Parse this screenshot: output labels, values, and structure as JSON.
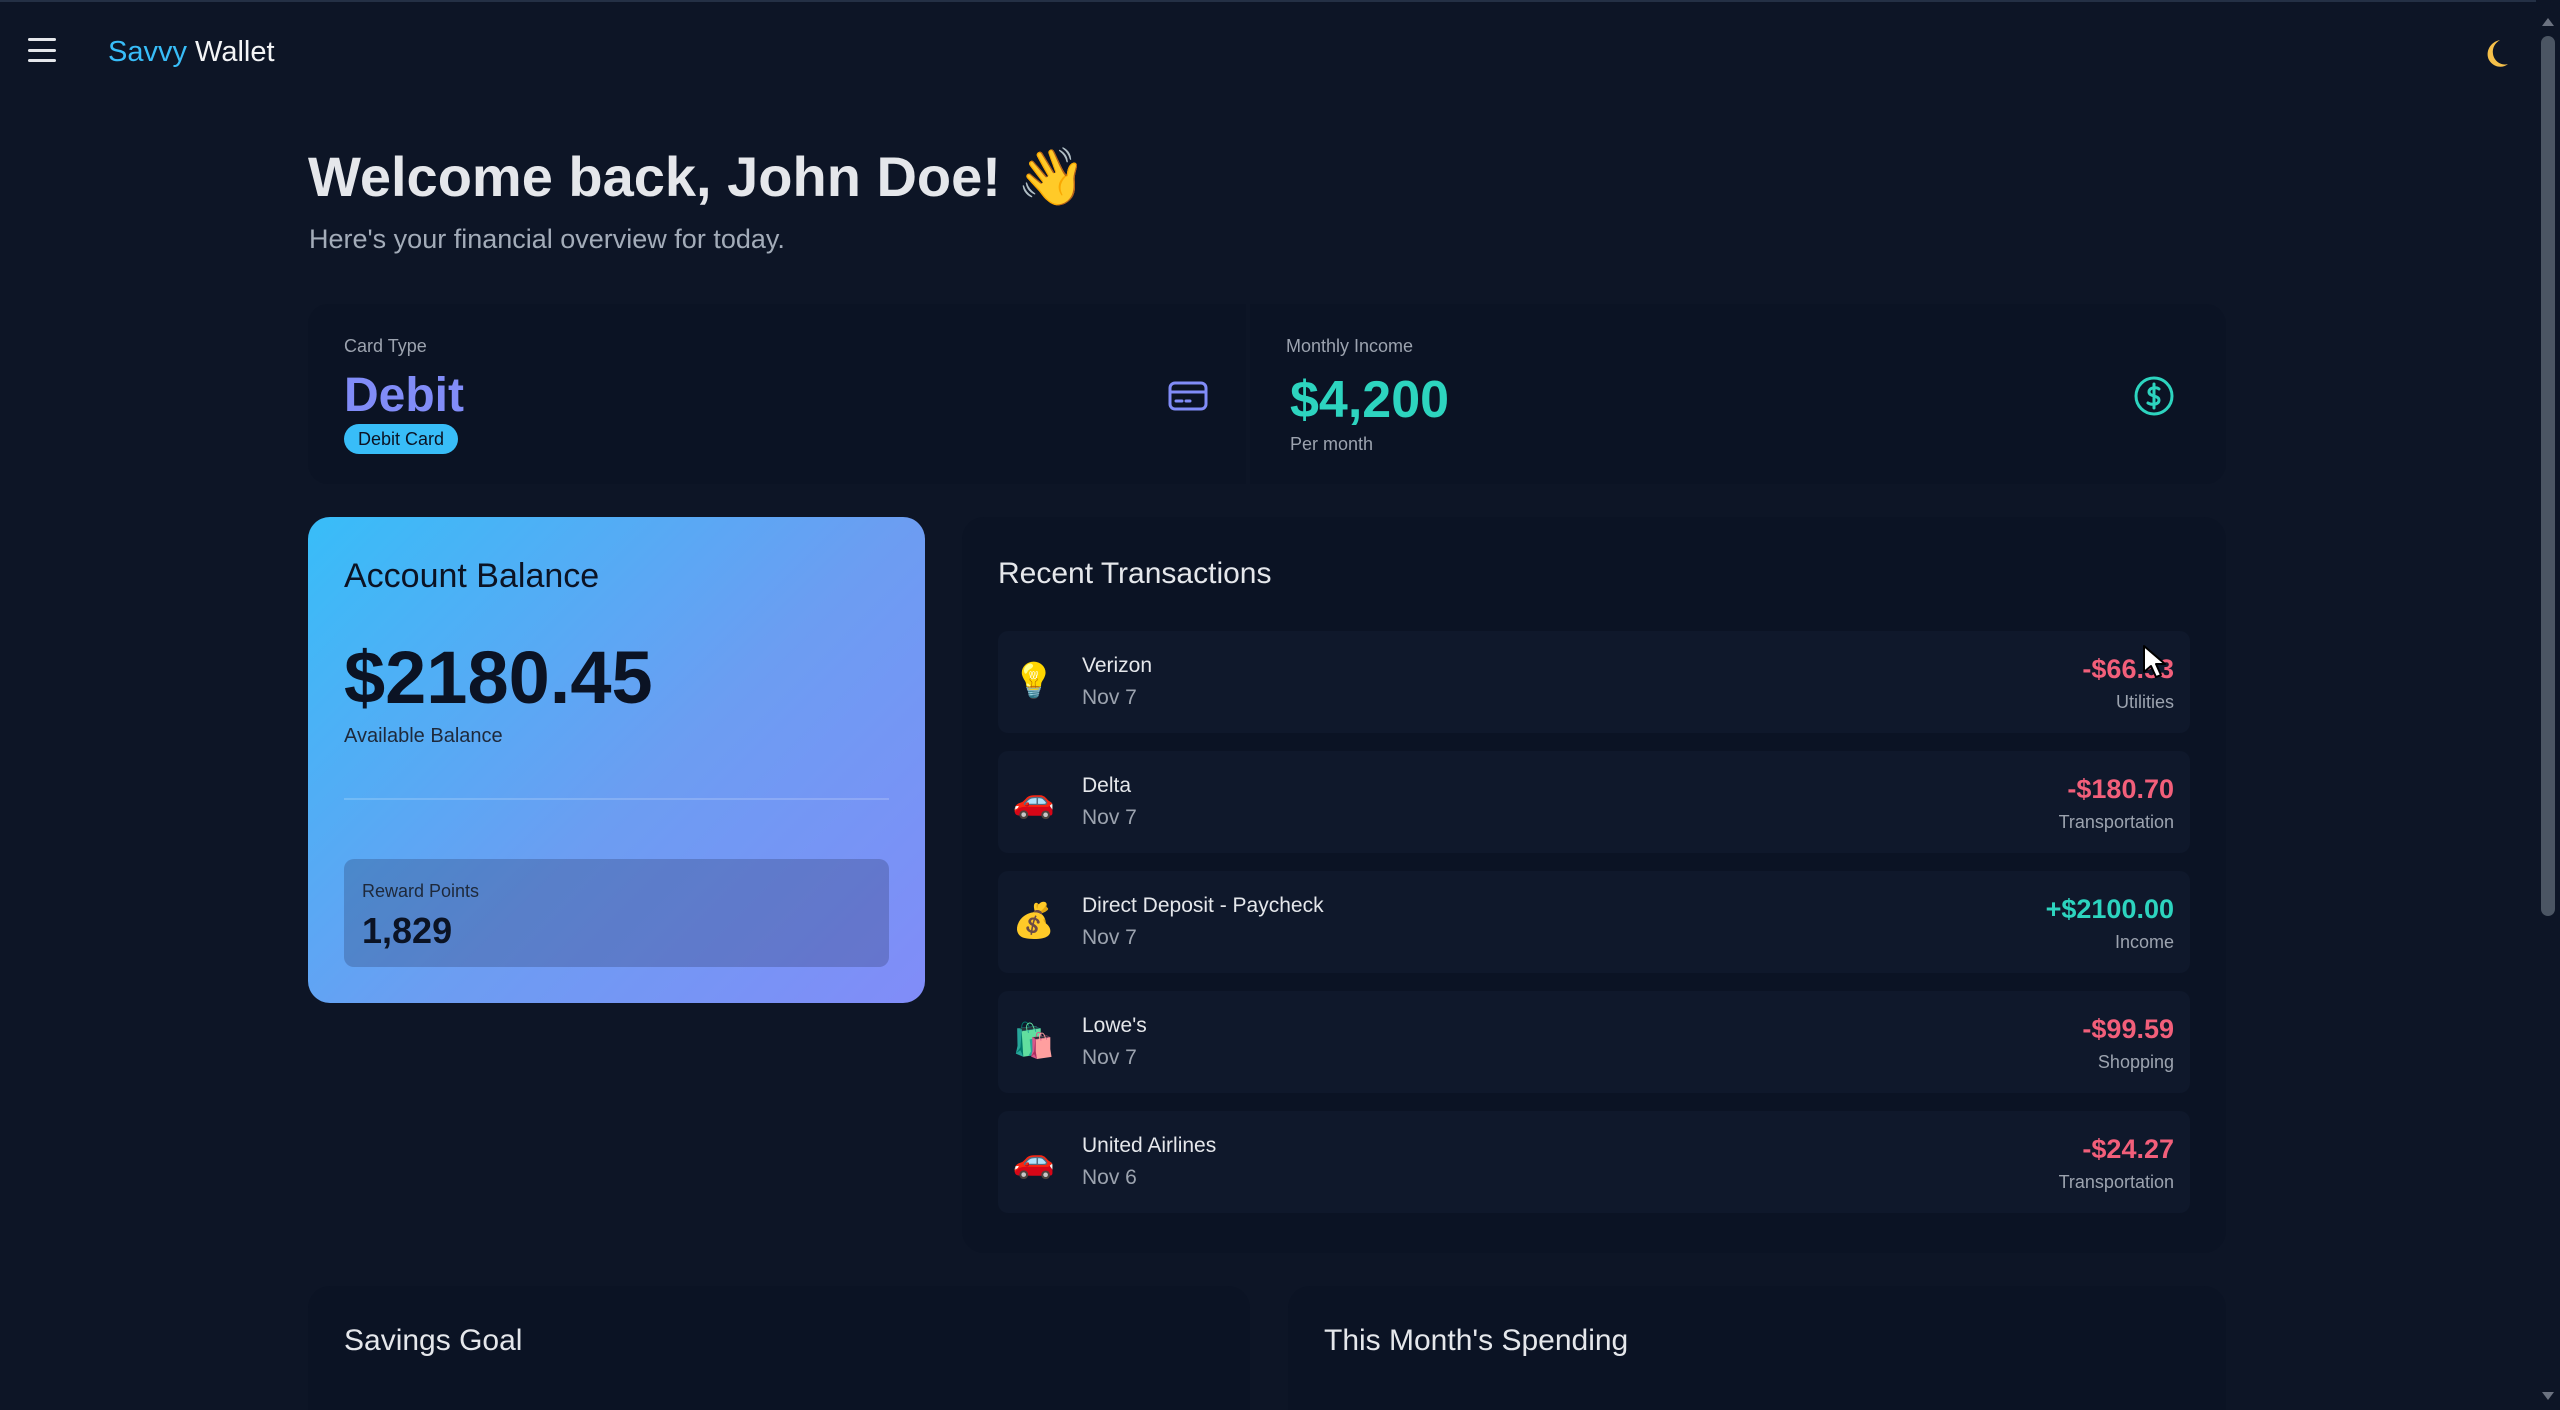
{
  "header": {
    "menu_icon": "hamburger-menu-icon",
    "brand_first": "Savvy",
    "brand_second": "Wallet",
    "theme_icon": "moon-icon"
  },
  "welcome": {
    "title": "Welcome back, John Doe! 👋",
    "subtitle": "Here's your financial overview for today."
  },
  "stats": {
    "card_type": {
      "label": "Card Type",
      "value": "Debit",
      "badge": "Debit Card",
      "icon": "credit-card-icon"
    },
    "monthly_income": {
      "label": "Monthly Income",
      "value": "$4,200",
      "sub": "Per month",
      "icon": "dollar-circle-icon"
    }
  },
  "balance": {
    "title": "Account Balance",
    "amount": "$2180.45",
    "sub": "Available Balance",
    "reward_label": "Reward Points",
    "reward_value": "1,829"
  },
  "transactions": {
    "title": "Recent Transactions",
    "items": [
      {
        "icon": "💡",
        "icon_name": "lightbulb-icon",
        "name": "Verizon",
        "date": "Nov 7",
        "amount": "-$66.53",
        "category": "Utilities",
        "direction": "neg"
      },
      {
        "icon": "🚗",
        "icon_name": "car-icon",
        "name": "Delta",
        "date": "Nov 7",
        "amount": "-$180.70",
        "category": "Transportation",
        "direction": "neg"
      },
      {
        "icon": "💰",
        "icon_name": "money-bag-icon",
        "name": "Direct Deposit - Paycheck",
        "date": "Nov 7",
        "amount": "+$2100.00",
        "category": "Income",
        "direction": "pos"
      },
      {
        "icon": "🛍️",
        "icon_name": "shopping-bags-icon",
        "name": "Lowe's",
        "date": "Nov 7",
        "amount": "-$99.59",
        "category": "Shopping",
        "direction": "neg"
      },
      {
        "icon": "🚗",
        "icon_name": "car-icon",
        "name": "United Airlines",
        "date": "Nov 6",
        "amount": "-$24.27",
        "category": "Transportation",
        "direction": "neg"
      }
    ]
  },
  "savings": {
    "title": "Savings Goal"
  },
  "spending": {
    "title": "This Month's Spending"
  },
  "colors": {
    "background": "#0d1526",
    "panel": "#0b1324",
    "accent_blue": "#38bdf8",
    "accent_indigo": "#818cf8",
    "accent_teal": "#2dd4bf",
    "negative": "#f25f7a"
  }
}
